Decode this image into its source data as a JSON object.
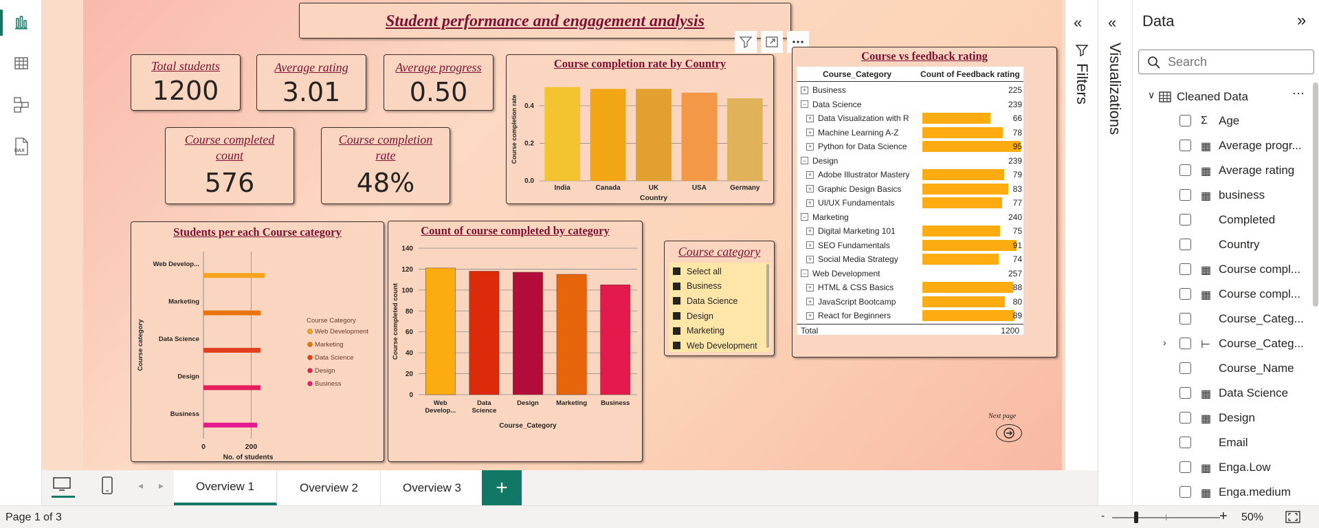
{
  "report": {
    "title": "Student performance and engagement analysis",
    "cards": {
      "total_students": {
        "label": "Total students",
        "value": "1200"
      },
      "average_rating": {
        "label": "Average rating",
        "value": "3.01"
      },
      "average_progress": {
        "label": "Average progress",
        "value": "0.50"
      },
      "course_completed_count": {
        "label": "Course completed count",
        "value": "576"
      },
      "course_completion_rate": {
        "label": "Course completion rate",
        "value": "48%"
      }
    },
    "next_page_label": "Next page"
  },
  "chart_data": [
    {
      "id": "completion_by_country",
      "type": "bar",
      "title": "Course completion rate by Country",
      "xlabel": "Country",
      "ylabel": "Course completion rate",
      "categories": [
        "India",
        "Canada",
        "UK",
        "USA",
        "Germany"
      ],
      "values": [
        0.5,
        0.49,
        0.49,
        0.47,
        0.44
      ],
      "colors": [
        "#f4c430",
        "#f2a614",
        "#e2a12e",
        "#f39847",
        "#e0b35a"
      ],
      "yticks": [
        "0.0",
        "0.2",
        "0.4"
      ],
      "ylim": [
        0,
        0.55
      ]
    },
    {
      "id": "students_per_category",
      "type": "bar",
      "orientation": "horizontal",
      "title": "Students per each Course category",
      "xlabel": "No. of students",
      "ylabel": "Course category",
      "categories": [
        "Web Develop...",
        "Marketing",
        "Data Science",
        "Design",
        "Business"
      ],
      "values": [
        257,
        240,
        239,
        239,
        225
      ],
      "colors": [
        "#f7a31d",
        "#e8740e",
        "#e0401f",
        "#e41e5c",
        "#e6198e"
      ],
      "xticks": [
        "0",
        "200"
      ],
      "xlim": [
        0,
        360
      ],
      "legend_title": "Course Category",
      "legend": [
        "Web Development",
        "Marketing",
        "Data Science",
        "Design",
        "Business"
      ]
    },
    {
      "id": "completed_by_category",
      "type": "bar",
      "title": "Count of course completed by category",
      "xlabel": "Course_Category",
      "ylabel": "Course completed count",
      "categories": [
        "Web Develop...",
        "Data Science",
        "Design",
        "Marketing",
        "Business"
      ],
      "values": [
        121,
        118,
        117,
        115,
        105
      ],
      "colors": [
        "#fcab10",
        "#dd2a0b",
        "#b20d3a",
        "#e6650a",
        "#e4194c"
      ],
      "yticks": [
        "0",
        "20",
        "40",
        "60",
        "80",
        "100",
        "120",
        "140"
      ],
      "ylim": [
        0,
        140
      ]
    }
  ],
  "slicer": {
    "title": "Course category",
    "items": [
      "Select all",
      "Business",
      "Data Science",
      "Design",
      "Marketing",
      "Web Development"
    ]
  },
  "matrix": {
    "title": "Course vs feedback rating",
    "col1": "Course_Category",
    "col2": "Count of Feedback rating",
    "max_value": 95,
    "rows": [
      {
        "label": "Business",
        "value": "225",
        "level": 0,
        "expander": "+"
      },
      {
        "label": "Data Science",
        "value": "239",
        "level": 0,
        "expander": "−"
      },
      {
        "label": "Data Visualization with R",
        "value": "66",
        "level": 1,
        "expander": "+",
        "bar": 66
      },
      {
        "label": "Machine Learning A-Z",
        "value": "78",
        "level": 1,
        "expander": "+",
        "bar": 78
      },
      {
        "label": "Python for Data Science",
        "value": "95",
        "level": 1,
        "expander": "+",
        "bar": 95
      },
      {
        "label": "Design",
        "value": "239",
        "level": 0,
        "expander": "−"
      },
      {
        "label": "Adobe Illustrator Mastery",
        "value": "79",
        "level": 1,
        "expander": "+",
        "bar": 79
      },
      {
        "label": "Graphic Design Basics",
        "value": "83",
        "level": 1,
        "expander": "+",
        "bar": 83
      },
      {
        "label": "UI/UX Fundamentals",
        "value": "77",
        "level": 1,
        "expander": "+",
        "bar": 77
      },
      {
        "label": "Marketing",
        "value": "240",
        "level": 0,
        "expander": "−"
      },
      {
        "label": "Digital Marketing 101",
        "value": "75",
        "level": 1,
        "expander": "+",
        "bar": 75
      },
      {
        "label": "SEO Fundamentals",
        "value": "91",
        "level": 1,
        "expander": "+",
        "bar": 91
      },
      {
        "label": "Social Media Strategy",
        "value": "74",
        "level": 1,
        "expander": "+",
        "bar": 74
      },
      {
        "label": "Web Development",
        "value": "257",
        "level": 0,
        "expander": "−"
      },
      {
        "label": "HTML & CSS Basics",
        "value": "88",
        "level": 1,
        "expander": "+",
        "bar": 88
      },
      {
        "label": "JavaScript Bootcamp",
        "value": "80",
        "level": 1,
        "expander": "+",
        "bar": 80
      },
      {
        "label": "React for Beginners",
        "value": "89",
        "level": 1,
        "expander": "+",
        "bar": 89
      }
    ],
    "total_label": "Total",
    "total_value": "1200"
  },
  "panes": {
    "filters_label": "Filters",
    "visualizations_label": "Visualizations",
    "data_title": "Data",
    "search_placeholder": "Search",
    "table_name": "Cleaned Data",
    "fields": [
      {
        "name": "Age",
        "icon": "sigma-icon",
        "glyph": "Σ"
      },
      {
        "name": "Average progr...",
        "icon": "calculator-icon",
        "glyph": "▦"
      },
      {
        "name": "Average rating",
        "icon": "calculator-icon",
        "glyph": "▦"
      },
      {
        "name": "business",
        "icon": "calculator-icon",
        "glyph": "▦"
      },
      {
        "name": "Completed",
        "icon": "",
        "glyph": ""
      },
      {
        "name": "Country",
        "icon": "",
        "glyph": ""
      },
      {
        "name": "Course compl...",
        "icon": "calculator-icon",
        "glyph": "▦"
      },
      {
        "name": "Course compl...",
        "icon": "calculator-icon",
        "glyph": "▦"
      },
      {
        "name": "Course_Categ...",
        "icon": "",
        "glyph": ""
      },
      {
        "name": "Course_Categ...",
        "icon": "hierarchy-icon",
        "glyph": "⊢",
        "expandable": true
      },
      {
        "name": "Course_Name",
        "icon": "",
        "glyph": ""
      },
      {
        "name": "Data Science",
        "icon": "calculator-icon",
        "glyph": "▦"
      },
      {
        "name": "Design",
        "icon": "calculator-icon",
        "glyph": "▦"
      },
      {
        "name": "Email",
        "icon": "",
        "glyph": ""
      },
      {
        "name": "Enga.Low",
        "icon": "calculator-icon",
        "glyph": "▦"
      },
      {
        "name": "Enga.medium",
        "icon": "calculator-icon",
        "glyph": "▦"
      }
    ]
  },
  "tabs": [
    "Overview 1",
    "Overview 2",
    "Overview 3"
  ],
  "active_tab": "Overview 1",
  "status": {
    "page": "Page 1 of 3",
    "zoom": "50%",
    "zoom_minus": "-",
    "zoom_plus": "+",
    "zoom_level": 0.5
  },
  "colors": {
    "accent": "#117865",
    "title": "#7c1133"
  }
}
